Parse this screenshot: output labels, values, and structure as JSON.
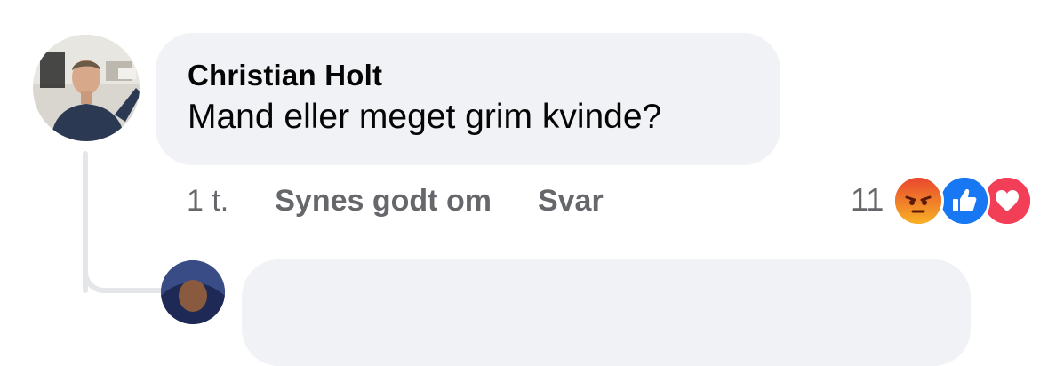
{
  "comment": {
    "author": "Christian Holt",
    "text": "Mand eller meget grim kvinde?",
    "timestamp": "1 t.",
    "like_label": "Synes godt om",
    "reply_label": "Svar"
  },
  "reactions": {
    "count": "11",
    "icons": [
      "angry-reaction-icon",
      "like-reaction-icon",
      "love-reaction-icon"
    ],
    "colors": {
      "angry": "#f0643a",
      "like": "#1877f2",
      "love": "#f33e58"
    }
  },
  "colors": {
    "bubble_bg": "#f0f2f5",
    "text_primary": "#050505",
    "text_secondary": "#65676b",
    "thread_line": "#e4e6ea"
  }
}
